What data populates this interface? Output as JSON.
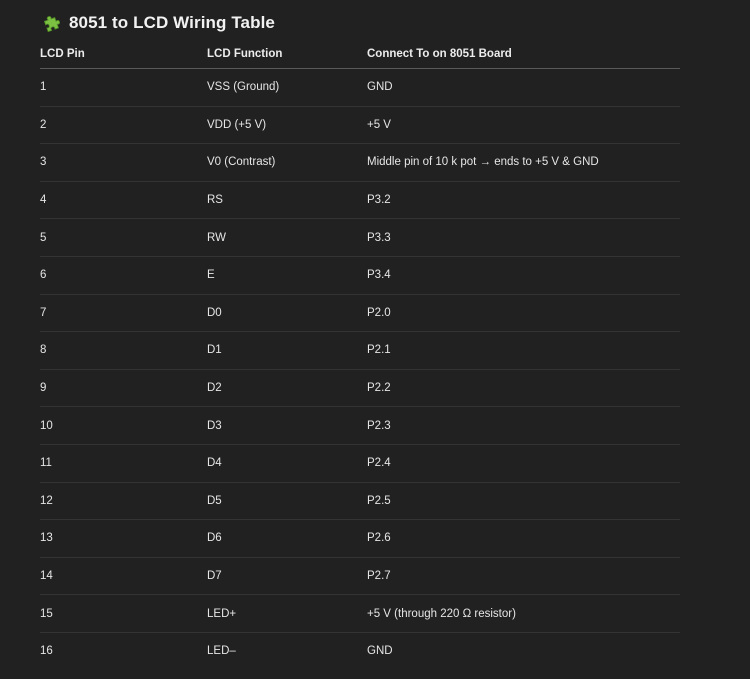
{
  "heading": {
    "icon": "puzzle-piece-icon",
    "title": "8051 to LCD Wiring Table"
  },
  "table": {
    "columns": [
      "LCD Pin",
      "LCD Function",
      "Connect To on 8051 Board"
    ],
    "rows": [
      [
        "1",
        "VSS (Ground)",
        "GND"
      ],
      [
        "2",
        "VDD (+5 V)",
        "+5 V"
      ],
      [
        "3",
        "V0 (Contrast)",
        "Middle pin of 10 k pot → ends to +5 V & GND"
      ],
      [
        "4",
        "RS",
        "P3.2"
      ],
      [
        "5",
        "RW",
        "P3.3"
      ],
      [
        "6",
        "E",
        "P3.4"
      ],
      [
        "7",
        "D0",
        "P2.0"
      ],
      [
        "8",
        "D1",
        "P2.1"
      ],
      [
        "9",
        "D2",
        "P2.2"
      ],
      [
        "10",
        "D3",
        "P2.3"
      ],
      [
        "11",
        "D4",
        "P2.4"
      ],
      [
        "12",
        "D5",
        "P2.5"
      ],
      [
        "13",
        "D6",
        "P2.6"
      ],
      [
        "14",
        "D7",
        "P2.7"
      ],
      [
        "15",
        "LED+",
        "+5 V (through 220 Ω resistor)"
      ],
      [
        "16",
        "LED–",
        "GND"
      ]
    ]
  },
  "colors": {
    "background": "#212121",
    "icon_green": "#7cc142"
  }
}
